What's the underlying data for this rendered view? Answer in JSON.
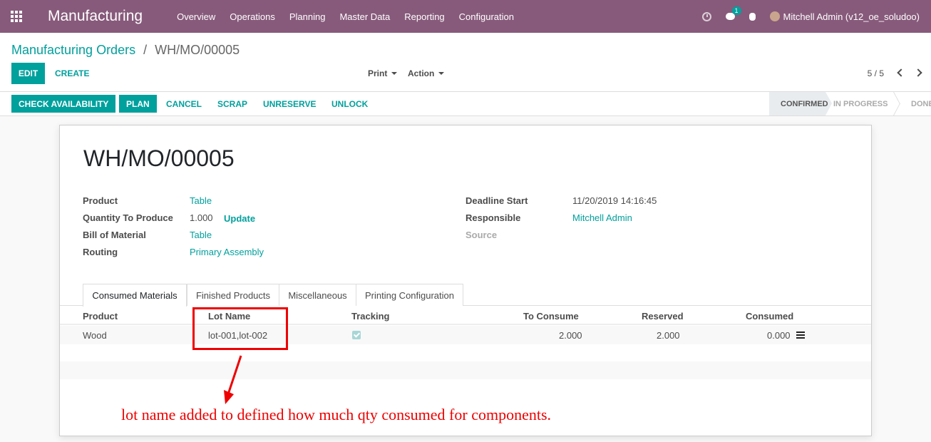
{
  "navbar": {
    "app_name": "Manufacturing",
    "menu": [
      "Overview",
      "Operations",
      "Planning",
      "Master Data",
      "Reporting",
      "Configuration"
    ],
    "chat_badge": "1",
    "user": "Mitchell Admin (v12_oe_soludoo)",
    "icons": [
      "apps-grid-icon",
      "clock-icon",
      "chat-icon",
      "bug-icon"
    ]
  },
  "breadcrumb": {
    "parent": "Manufacturing Orders",
    "separator": "/",
    "current": "WH/MO/00005"
  },
  "buttons": {
    "edit": "EDIT",
    "create": "CREATE",
    "print": "Print",
    "action": "Action"
  },
  "pager": {
    "value": "5 / 5"
  },
  "statusbar": {
    "check_availability": "CHECK AVAILABILITY",
    "plan": "PLAN",
    "cancel": "CANCEL",
    "scrap": "SCRAP",
    "unreserve": "UNRESERVE",
    "unlock": "UNLOCK",
    "stages": [
      "CONFIRMED",
      "IN PROGRESS",
      "DONE"
    ],
    "active_stage": "CONFIRMED"
  },
  "form": {
    "title": "WH/MO/00005",
    "left": {
      "product_label": "Product",
      "product": "Table",
      "qty_label": "Quantity To Produce",
      "qty": "1.000",
      "update": "Update",
      "bom_label": "Bill of Material",
      "bom": "Table",
      "routing_label": "Routing",
      "routing": "Primary Assembly"
    },
    "right": {
      "deadline_label": "Deadline Start",
      "deadline": "11/20/2019 14:16:45",
      "responsible_label": "Responsible",
      "responsible": "Mitchell Admin",
      "source_label": "Source"
    },
    "tabs": [
      "Consumed Materials",
      "Finished Products",
      "Miscellaneous",
      "Printing Configuration"
    ],
    "active_tab": "Consumed Materials"
  },
  "table": {
    "headers": [
      "Product",
      "Lot Name",
      "Tracking",
      "To Consume",
      "Reserved",
      "Consumed"
    ],
    "rows": [
      {
        "product": "Wood",
        "lot_name": "lot-001,lot-002",
        "tracking": true,
        "to_consume": "2.000",
        "reserved": "2.000",
        "consumed": "0.000"
      }
    ]
  },
  "annotation": {
    "text": "lot name added to defined how much qty consumed for components.",
    "color": "#ee0000"
  },
  "colors": {
    "navbar": "#875a7b",
    "accent": "#00a09d"
  }
}
